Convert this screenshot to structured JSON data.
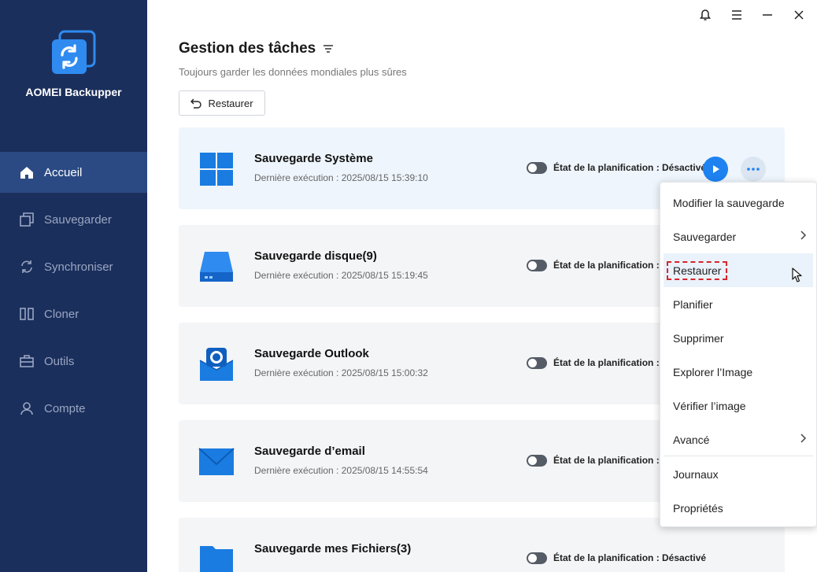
{
  "app": {
    "name": "AOMEI Backupper"
  },
  "sidebar": {
    "items": [
      {
        "label": "Accueil",
        "icon": "home-icon",
        "active": true
      },
      {
        "label": "Sauvegarder",
        "icon": "backup-icon",
        "active": false
      },
      {
        "label": "Synchroniser",
        "icon": "sync-icon",
        "active": false
      },
      {
        "label": "Cloner",
        "icon": "clone-icon",
        "active": false
      },
      {
        "label": "Outils",
        "icon": "tools-icon",
        "active": false
      },
      {
        "label": "Compte",
        "icon": "account-icon",
        "active": false
      }
    ]
  },
  "titlebar": {
    "icons": [
      "bell-icon",
      "menu-icon",
      "minimize-icon",
      "close-icon"
    ]
  },
  "header": {
    "title": "Gestion des tâches",
    "subtitle": "Toujours garder les données mondiales plus sûres",
    "restore_label": "Restaurer"
  },
  "tasks": [
    {
      "name": "Sauvegarde Système",
      "last_run": "Dernière exécution : 2025/08/15 15:39:10",
      "schedule": "État de la planification : Désactivé",
      "icon": "windows-icon"
    },
    {
      "name": "Sauvegarde disque(9)",
      "last_run": "Dernière exécution : 2025/08/15 15:19:45",
      "schedule": "État de la planification : D",
      "icon": "disk-icon"
    },
    {
      "name": "Sauvegarde Outlook",
      "last_run": "Dernière exécution : 2025/08/15 15:00:32",
      "schedule": "État de la planification : D",
      "icon": "outlook-icon"
    },
    {
      "name": "Sauvegarde d’email",
      "last_run": "Dernière exécution : 2025/08/15 14:55:54",
      "schedule": "État de la planification : D",
      "icon": "email-icon"
    },
    {
      "name": "Sauvegarde mes Fichiers(3)",
      "last_run": "",
      "schedule": "État de la planification : Désactivé",
      "icon": "folder-icon"
    }
  ],
  "context_menu": {
    "items": [
      "Modifier la sauvegarde",
      "Sauvegarder",
      "Restaurer",
      "Planifier",
      "Supprimer",
      "Explorer l’Image",
      "Vérifier l’image",
      "Avancé",
      "Journaux",
      "Propriétés"
    ]
  },
  "colors": {
    "sidebar": "#1b2f5c",
    "sidebar_active": "#2b4a84",
    "accent": "#1e82f0",
    "highlight": "#d6262b"
  }
}
